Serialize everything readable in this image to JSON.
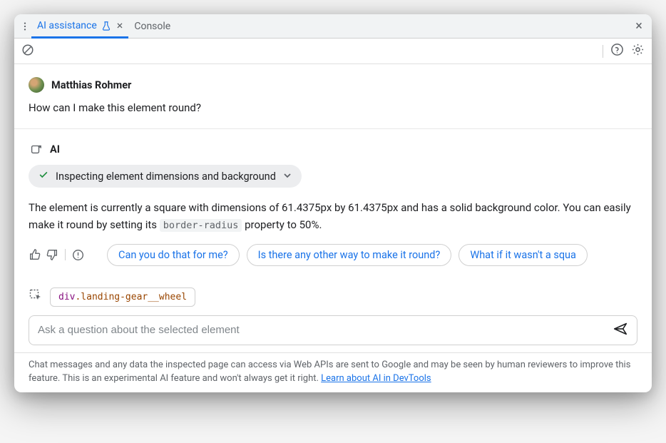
{
  "tabs": {
    "ai_assistance": "AI assistance",
    "console": "Console"
  },
  "user": {
    "name": "Matthias Rohmer",
    "message": "How can I make this element round?"
  },
  "ai": {
    "label": "AI",
    "status": "Inspecting element dimensions and background",
    "response_pre": "The element is currently a square with dimensions of 61.4375px by 61.4375px and has a solid background color. You can easily make it round by setting its ",
    "code": "border-radius",
    "response_post": " property to 50%."
  },
  "suggestions": [
    "Can you do that for me?",
    "Is there any other way to make it round?",
    "What if it wasn't a squa"
  ],
  "element": {
    "tag": "div",
    "class": ".landing-gear__wheel"
  },
  "input": {
    "placeholder": "Ask a question about the selected element"
  },
  "disclaimer": {
    "text": "Chat messages and any data the inspected page can access via Web APIs are sent to Google and may be seen by human reviewers to improve this feature. This is an experimental AI feature and won't always get it right. ",
    "link": "Learn about AI in DevTools"
  }
}
